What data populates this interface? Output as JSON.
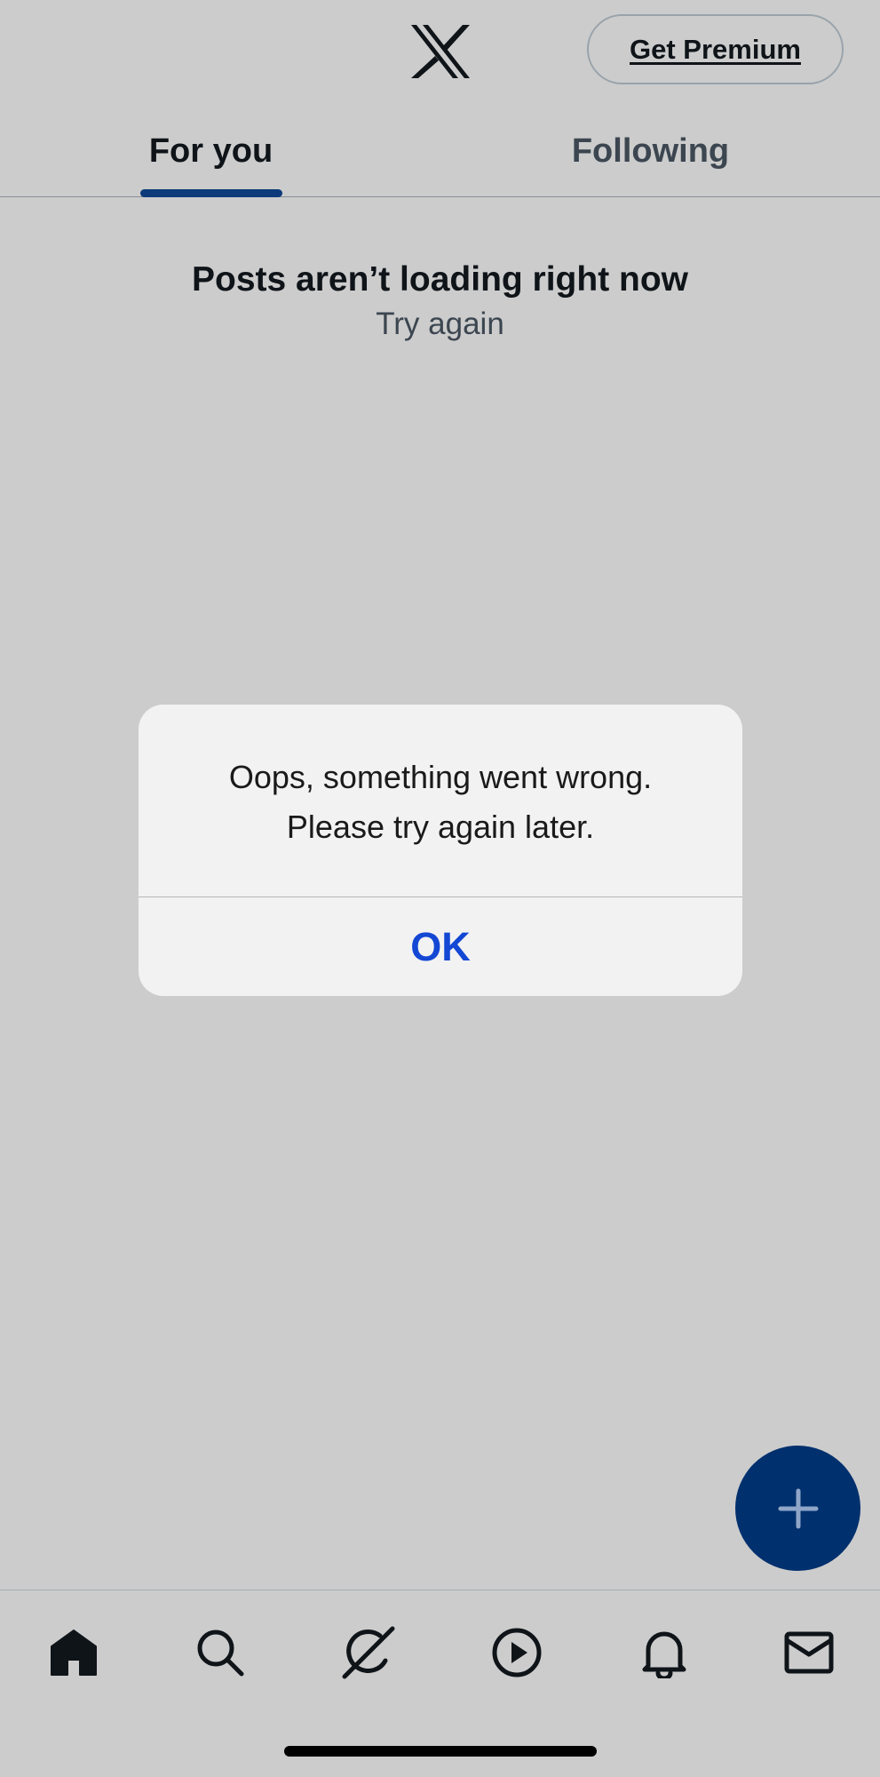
{
  "header": {
    "logo_icon": "x-logo-icon",
    "premium_label": "Get Premium",
    "tabs": [
      {
        "label": "For you",
        "active": true
      },
      {
        "label": "Following",
        "active": false
      }
    ]
  },
  "feed": {
    "error_title": "Posts aren’t loading right now",
    "retry_label": "Try again"
  },
  "alert": {
    "line1": "Oops, something went wrong.",
    "line2": "Please try again later.",
    "ok_label": "OK"
  },
  "fab": {
    "icon": "plus-icon"
  },
  "bottom_nav": {
    "items": [
      {
        "icon": "home-icon",
        "active": true
      },
      {
        "icon": "search-icon",
        "active": false
      },
      {
        "icon": "grok-icon",
        "active": false
      },
      {
        "icon": "video-play-icon",
        "active": false
      },
      {
        "icon": "bell-icon",
        "active": false
      },
      {
        "icon": "mail-icon",
        "active": false
      }
    ]
  },
  "colors": {
    "background": "#cccccc",
    "tab_indicator": "#0d3a7a",
    "fab": "#01306e",
    "alert_ok": "#1347d4",
    "text_primary": "#0f1419",
    "text_secondary": "#3c4650"
  }
}
